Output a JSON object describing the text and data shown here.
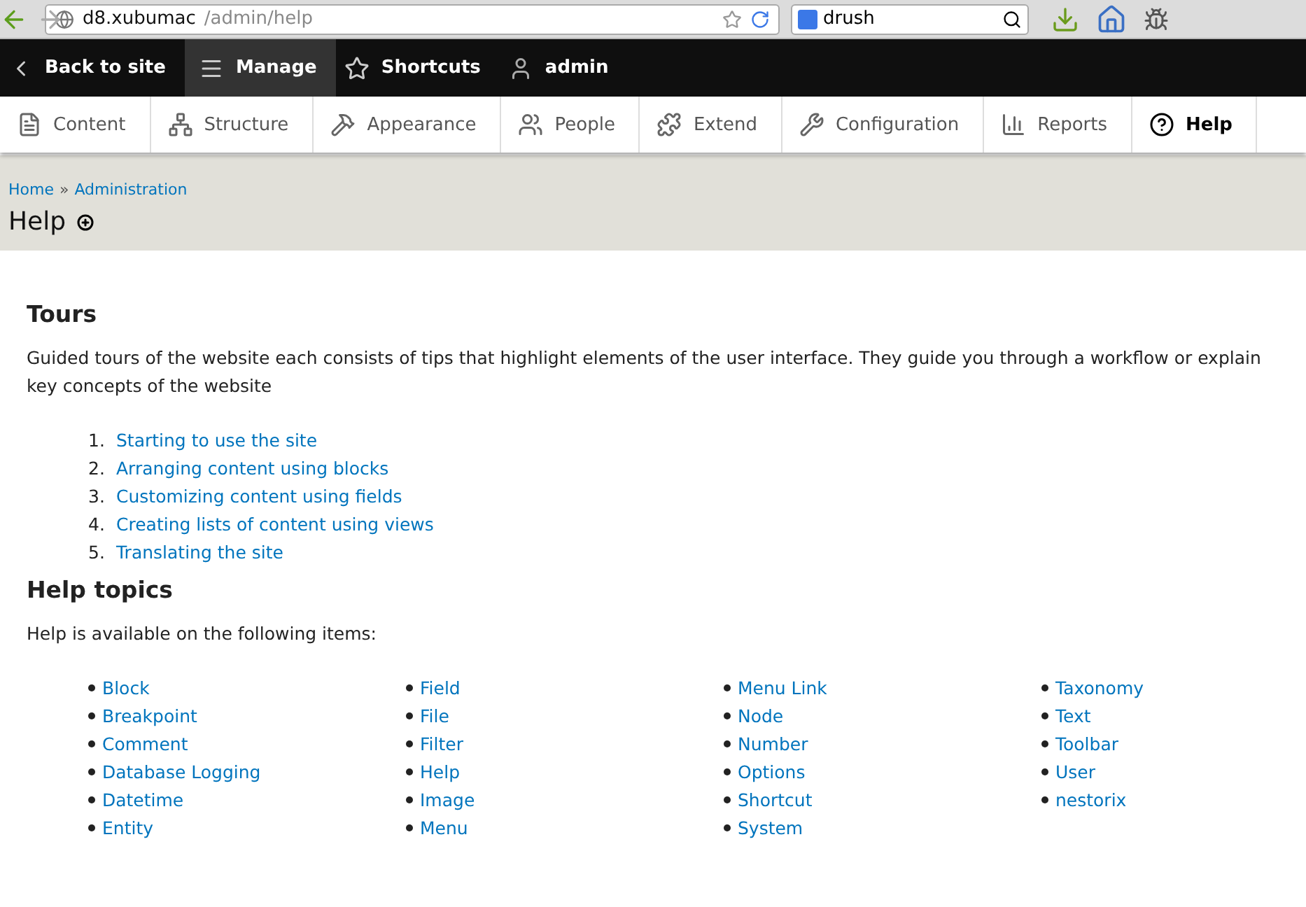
{
  "browser": {
    "url_host": "d8.xubumac",
    "url_path": "/admin/help",
    "search_value": "drush"
  },
  "toolbar": {
    "items": [
      {
        "kind": "back",
        "label": "Back to site",
        "selected": false
      },
      {
        "kind": "manage",
        "label": "Manage",
        "selected": true
      },
      {
        "kind": "shortcuts",
        "label": "Shortcuts",
        "selected": false
      },
      {
        "kind": "user",
        "label": "admin",
        "selected": false
      }
    ]
  },
  "tray": {
    "items": [
      {
        "kind": "content",
        "label": "Content",
        "selected": false
      },
      {
        "kind": "structure",
        "label": "Structure",
        "selected": false
      },
      {
        "kind": "appearance",
        "label": "Appearance",
        "selected": false
      },
      {
        "kind": "people",
        "label": "People",
        "selected": false
      },
      {
        "kind": "extend",
        "label": "Extend",
        "selected": false
      },
      {
        "kind": "configuration",
        "label": "Configuration",
        "selected": false
      },
      {
        "kind": "reports",
        "label": "Reports",
        "selected": false
      },
      {
        "kind": "help",
        "label": "Help",
        "selected": true
      }
    ]
  },
  "breadcrumb": {
    "items": [
      "Home",
      "Administration"
    ],
    "separator": "»"
  },
  "page_title": "Help",
  "tours": {
    "heading": "Tours",
    "description": "Guided tours of the website each consists of tips that highlight elements of the user interface. They guide you through a workflow or explain key concepts of the website",
    "items": [
      {
        "number": "1.",
        "label": "Starting to use the site"
      },
      {
        "number": "2.",
        "label": "Arranging content using blocks"
      },
      {
        "number": "3.",
        "label": "Customizing content using fields"
      },
      {
        "number": "4.",
        "label": "Creating lists of content using views"
      },
      {
        "number": "5.",
        "label": "Translating the site"
      }
    ]
  },
  "help_topics": {
    "heading": "Help topics",
    "intro": "Help is available on the following items:",
    "columns": [
      [
        "Block",
        "Breakpoint",
        "Comment",
        "Database Logging",
        "Datetime",
        "Entity"
      ],
      [
        "Field",
        "File",
        "Filter",
        "Help",
        "Image",
        "Menu"
      ],
      [
        "Menu Link",
        "Node",
        "Number",
        "Options",
        "Shortcut",
        "System"
      ],
      [
        "Taxonomy",
        "Text",
        "Toolbar",
        "User",
        "nestorix"
      ]
    ]
  }
}
